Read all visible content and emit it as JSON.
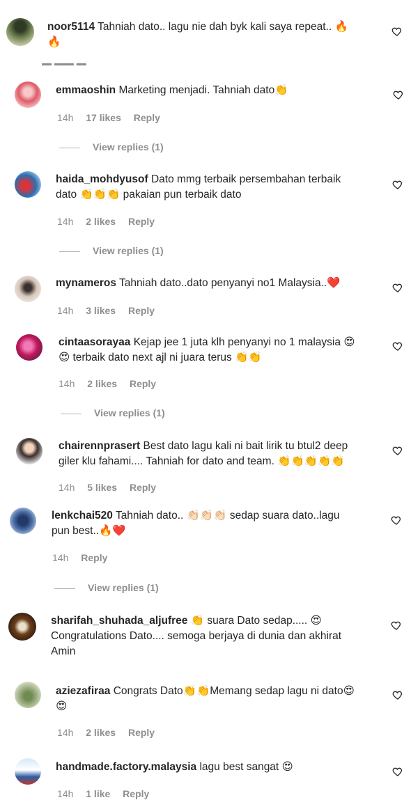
{
  "comments": [
    {
      "user": "noor5114",
      "text": "Tahniah dato.. lagu nie dah byk kali saya repeat.. 🔥",
      "text2": "🔥",
      "time": "",
      "likes": "",
      "reply": "",
      "view": ""
    },
    {
      "user": "emmaoshin",
      "text": "Marketing menjadi. Tahniah dato👏",
      "text2": "",
      "time": "14h",
      "likes": "17 likes",
      "reply": "Reply",
      "view": "View replies (1)"
    },
    {
      "user": "haida_mohdyusof",
      "text": "Dato mmg terbaik persembahan terbaik",
      "text2": "dato 👏👏👏 pakaian pun terbaik dato",
      "time": "14h",
      "likes": "2 likes",
      "reply": "Reply",
      "view": "View replies (1)"
    },
    {
      "user": "mynameros",
      "text": "Tahniah dato..dato penyanyi no1 Malaysia..❤️",
      "text2": "",
      "time": "14h",
      "likes": "3 likes",
      "reply": "Reply",
      "view": ""
    },
    {
      "user": "cintaasorayaa",
      "text": "Kejap jee 1 juta klh penyanyi no 1 malaysia 😍",
      "text2": "😍 terbaik dato next ajl ni juara terus 👏👏",
      "time": "14h",
      "likes": "2 likes",
      "reply": "Reply",
      "view": "View replies (1)"
    },
    {
      "user": "chairennprasert",
      "text": "Best dato lagu kali ni bait lirik tu btul2 deep",
      "text2": "giler klu fahami.... Tahniah for dato and team. 👏👏👏👏👏",
      "time": "14h",
      "likes": "5 likes",
      "reply": "Reply",
      "view": ""
    },
    {
      "user": "lenkchai520",
      "text": "Tahniah dato.. 👏🏻👏🏻👏🏻 sedap suara dato..lagu",
      "text2": "pun best..🔥❤️",
      "time": "14h",
      "likes": "",
      "reply": "Reply",
      "view": "View replies (1)"
    },
    {
      "user": "sharifah_shuhada_aljufree",
      "text": "👏 suara Dato sedap..... 😍",
      "text2": "Congratulations Dato.... semoga berjaya di dunia dan akhirat",
      "text3": "Amin",
      "time": "",
      "likes": "",
      "reply": "",
      "view": ""
    },
    {
      "user": "aziezafiraa",
      "text": "Congrats Dato👏👏Memang sedap lagu ni dato😍",
      "text2": "😍",
      "time": "14h",
      "likes": "2 likes",
      "reply": "Reply",
      "view": ""
    },
    {
      "user": "handmade.factory.malaysia",
      "text": "lagu best sangat 😍",
      "text2": "",
      "time": "14h",
      "likes": "1 like",
      "reply": "Reply",
      "view": ""
    }
  ],
  "colors": {
    "text": "#262626",
    "muted": "#8e8e8e",
    "divider": "#b0b0b0"
  },
  "icons": {
    "like": "heart-outline-icon"
  }
}
